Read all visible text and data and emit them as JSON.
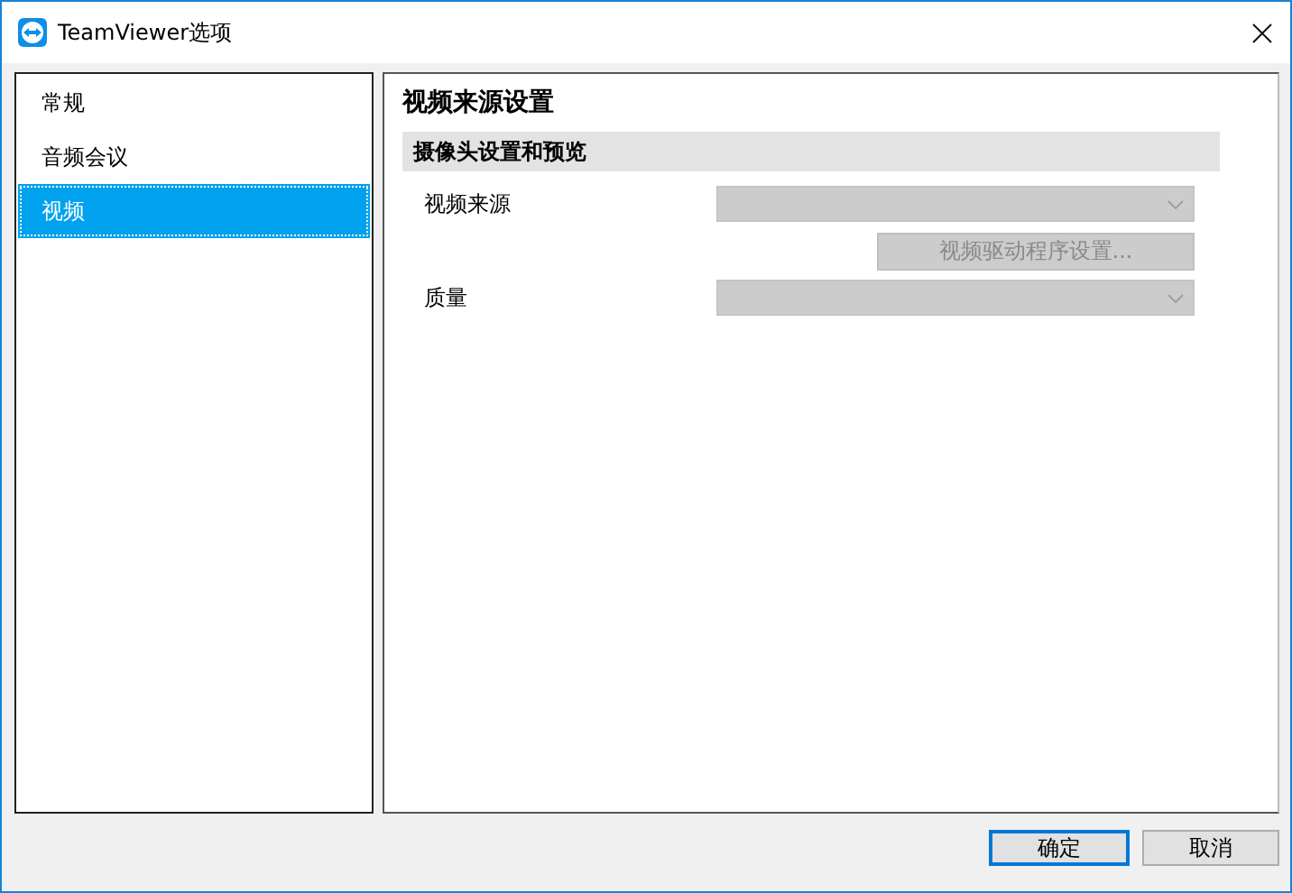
{
  "window": {
    "title": "TeamViewer选项"
  },
  "sidebar": {
    "items": [
      {
        "label": "常规",
        "selected": false
      },
      {
        "label": "音频会议",
        "selected": false
      },
      {
        "label": "视频",
        "selected": true
      }
    ]
  },
  "panel": {
    "title": "视频来源设置",
    "section": "摄像头设置和预览",
    "fields": [
      {
        "kind": "dropdown",
        "label": "视频来源",
        "disabled": true
      },
      {
        "kind": "button",
        "label": "视频驱动程序设置...",
        "disabled": true
      },
      {
        "kind": "dropdown",
        "label": "质量",
        "disabled": true
      }
    ]
  },
  "buttons": [
    {
      "label": "确定",
      "default": true
    },
    {
      "label": "取消",
      "default": false
    }
  ]
}
